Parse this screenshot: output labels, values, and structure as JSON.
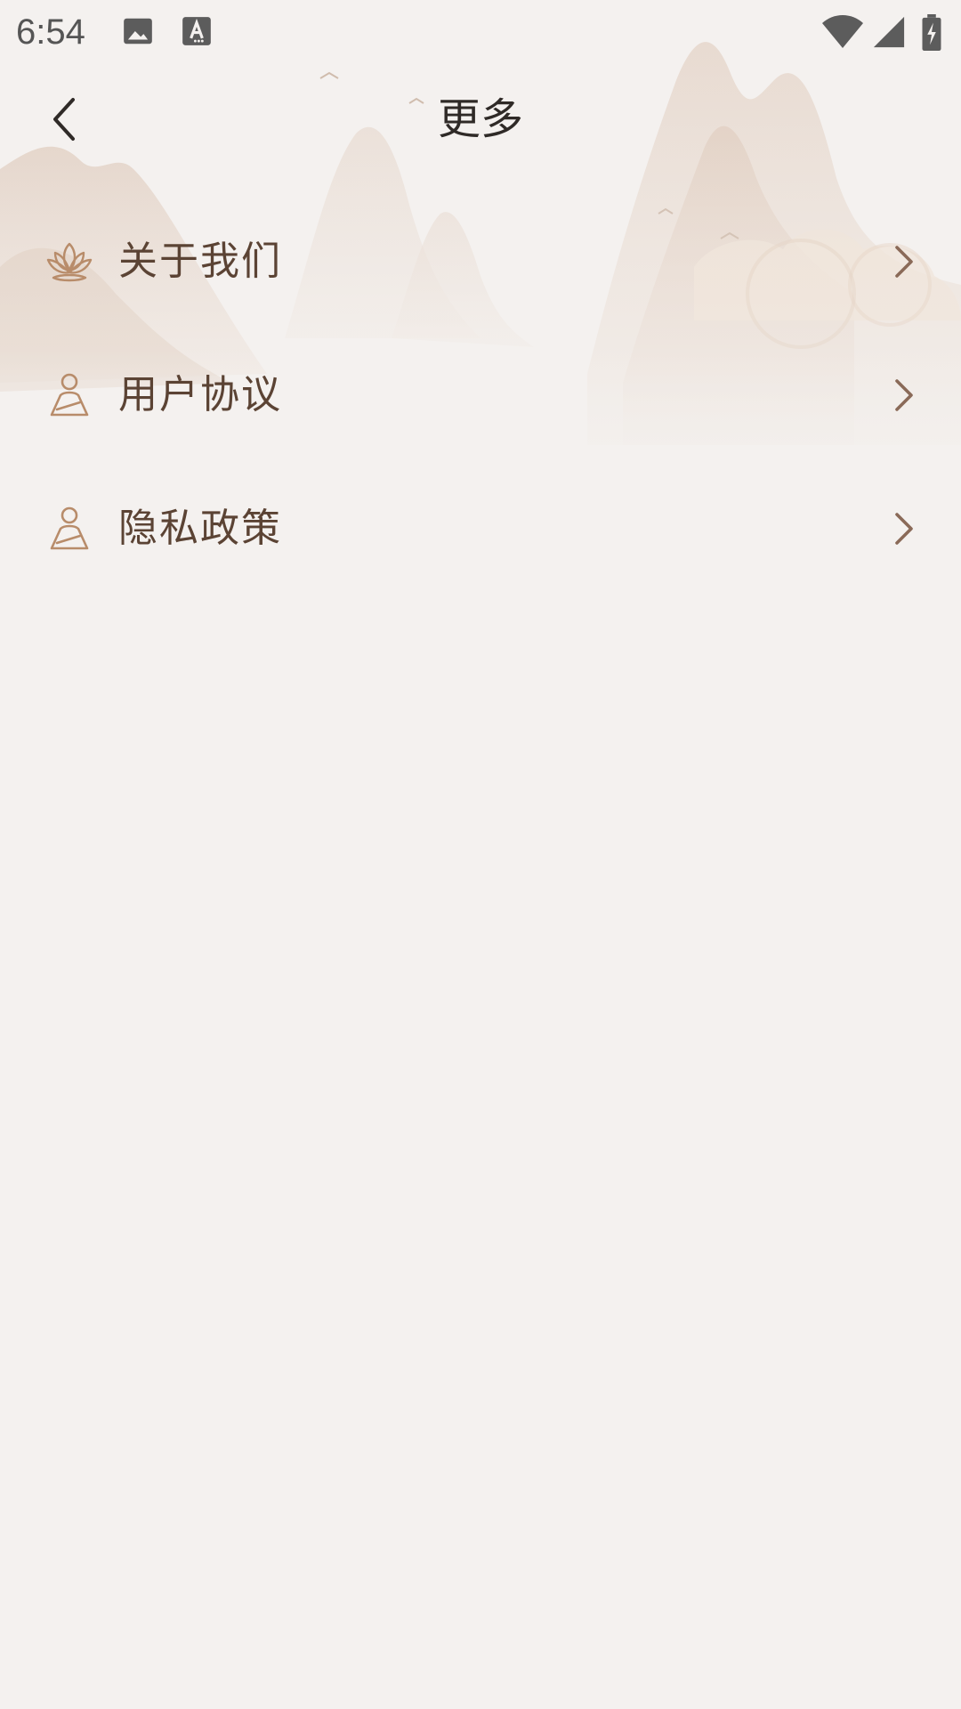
{
  "status_bar": {
    "time": "6:54",
    "left_icons": [
      "image-icon",
      "text-recognition-icon"
    ],
    "right_icons": [
      "wifi-icon",
      "cellular-signal-icon",
      "battery-charging-icon"
    ]
  },
  "header": {
    "back_icon": "chevron-left-icon",
    "title": "更多"
  },
  "menu": {
    "items": [
      {
        "label": "关于我们",
        "icon": "lotus-icon"
      },
      {
        "label": "用户协议",
        "icon": "meditating-person-icon"
      },
      {
        "label": "隐私政策",
        "icon": "meditating-person-icon"
      }
    ],
    "chevron_icon": "chevron-right-icon"
  },
  "colors": {
    "background": "#f4f1ef",
    "text_primary": "#2f2a27",
    "menu_text": "#5b4334",
    "icon_accent": "#b88c6a",
    "chevron": "#8a6a58"
  }
}
